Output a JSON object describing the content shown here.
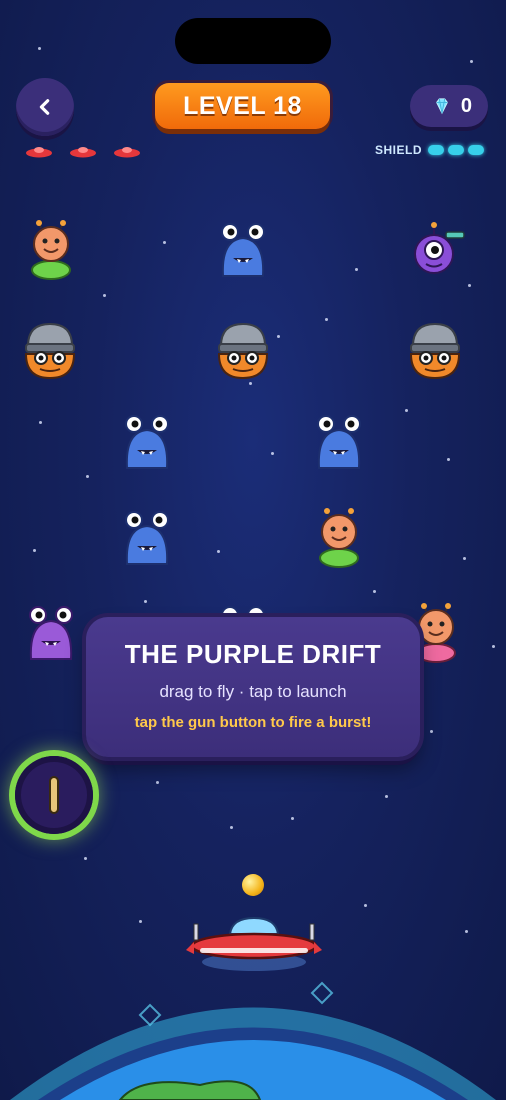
{
  "header": {
    "back_icon": "chevron-left-icon",
    "level_label": "LEVEL 18",
    "gems": {
      "icon": "diamond-icon",
      "count": "0",
      "color": "#7fe3ff"
    },
    "lives": {
      "count": 3,
      "color": "#e5373b"
    },
    "shield": {
      "label": "SHIELD",
      "segments": 3,
      "color": "#37d0ea"
    }
  },
  "enemies": [
    {
      "type": "orange-alien-green-ring",
      "row": 1,
      "col": 1
    },
    {
      "type": "blue-eyestalk-monster",
      "row": 1,
      "col": 3
    },
    {
      "type": "purple-cyclops-blaster",
      "row": 1,
      "col": 5
    },
    {
      "type": "orange-helmet-monster",
      "row": 2,
      "col": 1
    },
    {
      "type": "orange-helmet-monster",
      "row": 2,
      "col": 3
    },
    {
      "type": "orange-helmet-monster",
      "row": 2,
      "col": 5
    },
    {
      "type": "blue-eyestalk-monster",
      "row": 3,
      "col": 2
    },
    {
      "type": "blue-eyestalk-monster",
      "row": 3,
      "col": 4
    },
    {
      "type": "blue-eyestalk-monster",
      "row": 4,
      "col": 2
    },
    {
      "type": "orange-alien-green-ring",
      "row": 4,
      "col": 4
    },
    {
      "type": "purple-eyestalk-monster",
      "row": 5,
      "col": 1
    },
    {
      "type": "orange-alien-pink-ring",
      "row": 5,
      "col": 5
    }
  ],
  "tutorial": {
    "title": "THE PURPLE DRIFT",
    "subtitle": "drag to fly · tap to launch",
    "hint": "tap the gun button to fire a burst!"
  },
  "controls": {
    "gun_button_icon": "gun-icon",
    "accent": "#7fd84a"
  },
  "player": {
    "ship_icon": "ufo-ship-icon",
    "ball_icon": "ball-icon",
    "planet_icon": "planet-icon"
  }
}
